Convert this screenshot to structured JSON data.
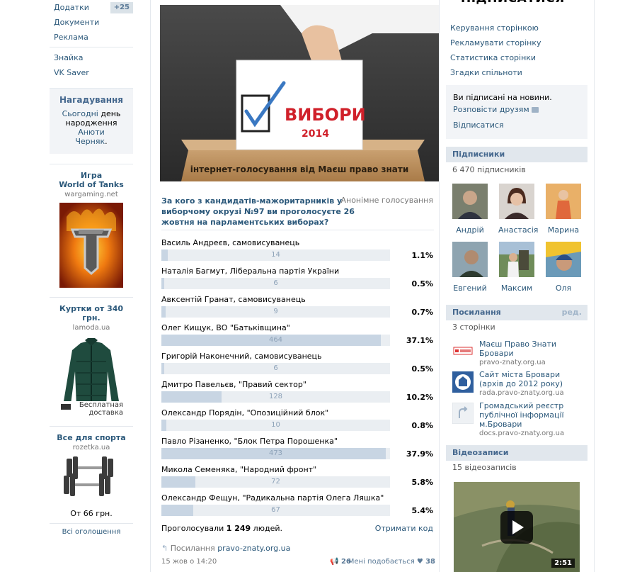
{
  "left_nav": {
    "items": [
      {
        "label": "Додатки",
        "badge": "+25"
      },
      {
        "label": "Документи"
      },
      {
        "label": "Реклама"
      }
    ],
    "items2": [
      {
        "label": "Знайка"
      },
      {
        "label": "VK Saver"
      }
    ]
  },
  "reminder": {
    "title": "Нагадування",
    "line1_link": "Сьогодні",
    "line1_text": " день",
    "line2_text": "народження ",
    "line2_link": "Анюти",
    "line3_link": "Черняк",
    "line3_text": "."
  },
  "ads": [
    {
      "title1": "Игра",
      "title2": "World of Tanks",
      "domain": "wargaming.net"
    },
    {
      "title1": "Куртки от 340 грн.",
      "domain": "lamoda.ua",
      "badge1": "Бесплатная",
      "badge2": "доставка"
    },
    {
      "title1": "Все для спорта",
      "domain": "rozetka.ua",
      "price": "От 66 грн."
    }
  ],
  "all_ads": "Всі оголошення",
  "banner": {
    "ballot_text1": "ВИБОРИ",
    "ballot_text2": "2014",
    "box_text": "інтернет-голосування від Маєш право знати"
  },
  "poll": {
    "question": "За кого з кандидатів-мажоритарників у виборчому окрузі №97 ви проголосуєте 26 жовтня на парламентських виборах?",
    "anonymous": "Анонімне голосування",
    "options": [
      {
        "label": "Василь Андреєв, самовисуванець",
        "count": "14",
        "percent": "1.1%",
        "share": 1.1
      },
      {
        "label": "Наталія Багмут, Ліберальна партія України",
        "count": "6",
        "percent": "0.5%",
        "share": 0.5
      },
      {
        "label": "Авксентій Гранат, самовисуванець",
        "count": "9",
        "percent": "0.7%",
        "share": 0.7
      },
      {
        "label": "Олег Кищук, ВО \"Батьківщина\"",
        "count": "464",
        "percent": "37.1%",
        "share": 37.1
      },
      {
        "label": "Григорій Наконечний, самовисуванець",
        "count": "6",
        "percent": "0.5%",
        "share": 0.5
      },
      {
        "label": "Дмитро Павельєв, \"Правий сектор\"",
        "count": "128",
        "percent": "10.2%",
        "share": 10.2
      },
      {
        "label": "Олександр Порядін, \"Опозиційний блок\"",
        "count": "10",
        "percent": "0.8%",
        "share": 0.8
      },
      {
        "label": "Павло Різаненко, \"Блок Петра Порошенка\"",
        "count": "473",
        "percent": "37.9%",
        "share": 37.9
      },
      {
        "label": "Микола Семеняка, \"Народний фронт\"",
        "count": "72",
        "percent": "5.8%",
        "share": 5.8
      },
      {
        "label": "Олександр Фещун, \"Радикальна партія Олега Ляшка\"",
        "count": "67",
        "percent": "5.4%",
        "share": 5.4
      }
    ],
    "voted_prefix": "Проголосували ",
    "voted_count": "1 249",
    "voted_suffix": " людей.",
    "get_code": "Отримати код"
  },
  "post": {
    "link_label": "Посилання ",
    "link_domain": "pravo-znaty.org.ua",
    "date": "15 жов о 14:20",
    "reposts": "26",
    "likes_label": "Мені подобається",
    "likes": "38"
  },
  "right": {
    "subscribe": "ПІДПИСАТИСЯ",
    "menu": [
      "Керування сторінкою",
      "Рекламувати сторінку",
      "Статистика сторінки",
      "Згадки спільноти"
    ],
    "subbox_text": "Ви підписані на новини.",
    "subbox_tell": "Розповісти друзям",
    "subbox_unsub": "Відписатися",
    "subs_title": "Підписники",
    "subs_count": "6 470 підписників",
    "subscribers": [
      "Андрій",
      "Анастасія",
      "Марина",
      "Евгений",
      "Максим",
      "Оля"
    ],
    "links_title": "Посилання",
    "links_edit": "ред.",
    "links_count": "3 сторінки",
    "links": [
      {
        "title": "Маєш Право Знати Бровари",
        "domain": "pravo-znaty.org.ua"
      },
      {
        "title": "Сайт міста Бровари (архів до 2012 року)",
        "domain": "rada.pravo-znaty.org.ua"
      },
      {
        "title": "Громадський реєстр публічної інформації м.Бровари",
        "domain": "docs.pravo-znaty.org.ua"
      }
    ],
    "videos_title": "Відеозаписи",
    "videos_count": "15 відеозаписів",
    "video_duration": "2:51"
  },
  "colors": {
    "link": "#2b587a",
    "header_bg": "#e1e7ed",
    "bar_fill": "#c8d5e3",
    "bar_bg": "#eaeef2"
  }
}
